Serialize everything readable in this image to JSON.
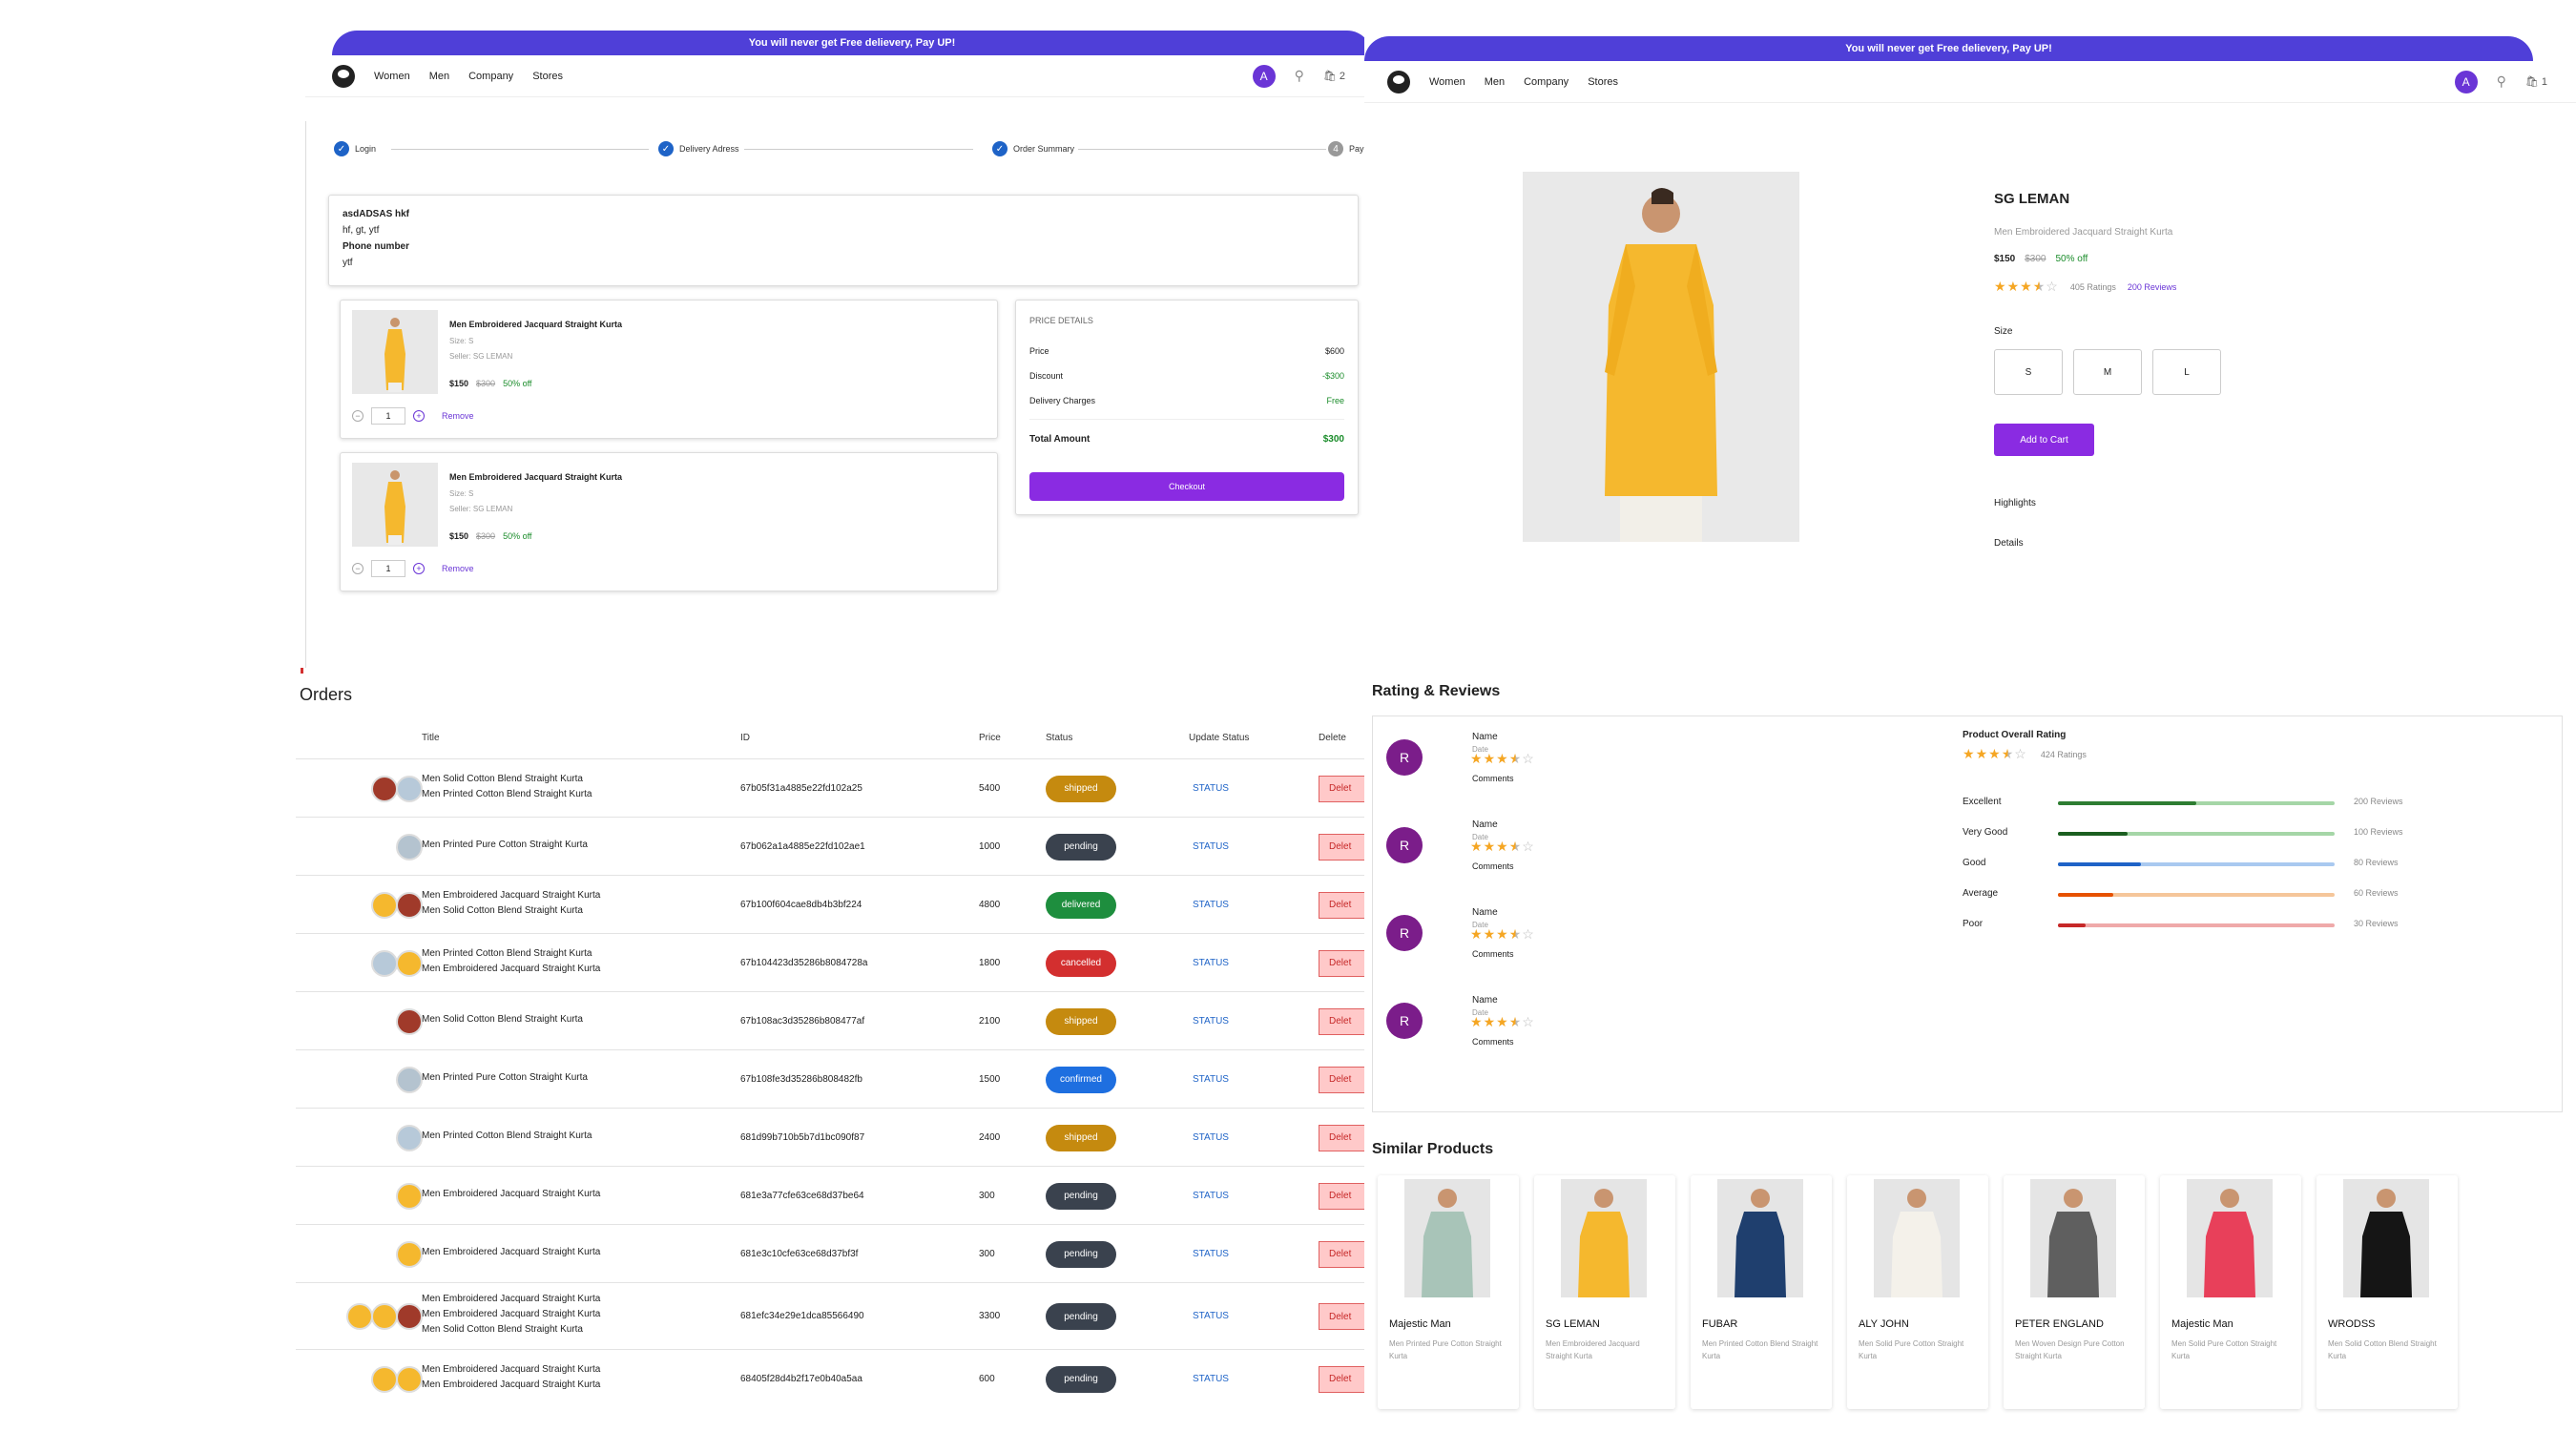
{
  "banner_text": "You will never get Free delievery, Pay UP!",
  "nav": {
    "women": "Women",
    "men": "Men",
    "company": "Company",
    "stores": "Stores",
    "avatar_letter": "A",
    "cart_count_left": "2",
    "cart_count_right": "1"
  },
  "checkout": {
    "steps": [
      "Login",
      "Delivery Adress",
      "Order Summary",
      "Payment"
    ],
    "address": {
      "name": "asdADSAS hkf",
      "line": "hf, gt, ytf",
      "phone_label": "Phone number",
      "phone": "ytf"
    },
    "items": [
      {
        "title": "Men Embroidered Jacquard Straight Kurta",
        "size": "Size: S",
        "seller": "Seller: SG LEMAN",
        "price": "$150",
        "mrp": "$300",
        "off": "50% off",
        "qty": "1",
        "remove": "Remove"
      },
      {
        "title": "Men Embroidered Jacquard Straight Kurta",
        "size": "Size: S",
        "seller": "Seller: SG LEMAN",
        "price": "$150",
        "mrp": "$300",
        "off": "50% off",
        "qty": "1",
        "remove": "Remove"
      }
    ],
    "price_details": {
      "heading": "PRICE DETAILS",
      "price_label": "Price",
      "price": "$600",
      "discount_label": "Discount",
      "discount": "-$300",
      "delivery_label": "Delivery Charges",
      "delivery": "Free",
      "total_label": "Total Amount",
      "total": "$300",
      "checkout": "Checkout"
    }
  },
  "product": {
    "brand": "SG LEMAN",
    "name": "Men Embroidered Jacquard Straight Kurta",
    "price": "$150",
    "mrp": "$300",
    "off": "50% off",
    "rating": 3.5,
    "ratings_text": "405 Ratings",
    "reviews_link": "200 Reviews",
    "size_label": "Size",
    "sizes": [
      "S",
      "M",
      "L"
    ],
    "add_to_cart": "Add to Cart",
    "highlights": "Highlights",
    "details": "Details"
  },
  "reviews": {
    "heading": "Rating & Reviews",
    "items": [
      {
        "initial": "R",
        "name": "Name",
        "date": "Date",
        "rating": 3.5,
        "comment": "Comments"
      },
      {
        "initial": "R",
        "name": "Name",
        "date": "Date",
        "rating": 3.5,
        "comment": "Comments"
      },
      {
        "initial": "R",
        "name": "Name",
        "date": "Date",
        "rating": 3.5,
        "comment": "Comments"
      },
      {
        "initial": "R",
        "name": "Name",
        "date": "Date",
        "rating": 3.5,
        "comment": "Comments"
      }
    ],
    "overall_title": "Product Overall Rating",
    "overall_rating": 3.5,
    "overall_count": "424 Ratings",
    "breakdown": [
      {
        "label": "Excellent",
        "count": "200 Reviews",
        "fraction": 0.5,
        "color": "#2e7d32",
        "bg": "#a5d6a7"
      },
      {
        "label": "Very Good",
        "count": "100 Reviews",
        "fraction": 0.25,
        "color": "#1b5e20",
        "bg": "#a5d6a7"
      },
      {
        "label": "Good",
        "count": "80 Reviews",
        "fraction": 0.3,
        "color": "#1e63c7",
        "bg": "#a9c9f0"
      },
      {
        "label": "Average",
        "count": "60 Reviews",
        "fraction": 0.2,
        "color": "#e65100",
        "bg": "#f5c69a"
      },
      {
        "label": "Poor",
        "count": "30 Reviews",
        "fraction": 0.1,
        "color": "#c62828",
        "bg": "#efa9a9"
      }
    ]
  },
  "similar": {
    "heading": "Similar Products",
    "items": [
      {
        "brand": "Majestic Man",
        "desc": "Men Printed Pure Cotton Straight Kurta",
        "color": "#a8c4b8"
      },
      {
        "brand": "SG LEMAN",
        "desc": "Men Embroidered Jacquard Straight Kurta",
        "color": "#f5b82e"
      },
      {
        "brand": "FUBAR",
        "desc": "Men Printed Cotton Blend Straight Kurta",
        "color": "#1f3f6e"
      },
      {
        "brand": "ALY JOHN",
        "desc": "Men Solid Pure Cotton Straight Kurta",
        "color": "#f4f1ea"
      },
      {
        "brand": "PETER ENGLAND",
        "desc": "Men Woven Design Pure Cotton Straight Kurta",
        "color": "#5f5f5f"
      },
      {
        "brand": "Majestic Man",
        "desc": "Men Solid Pure Cotton Straight Kurta",
        "color": "#e8405a"
      },
      {
        "brand": "WRODSS",
        "desc": "Men Solid Cotton Blend Straight Kurta",
        "color": "#151515"
      }
    ]
  },
  "orders": {
    "heading": "Orders",
    "columns": [
      "Title",
      "ID",
      "Price",
      "Status",
      "Update Status",
      "Delete"
    ],
    "status_link": "STATUS",
    "delete_label": "Delet",
    "rows": [
      {
        "titles": [
          "Men Solid Cotton Blend Straight Kurta",
          "Men Printed Cotton Blend Straight Kurta"
        ],
        "id": "67b05f31a4885e22fd102a25",
        "price": "5400",
        "status": "shipped",
        "thumbs": [
          "#a03a2a",
          "#b7c9d9"
        ]
      },
      {
        "titles": [
          "Men Printed Pure Cotton Straight Kurta"
        ],
        "id": "67b062a1a4885e22fd102ae1",
        "price": "1000",
        "status": "pending",
        "thumbs": [
          "#b4c3cf"
        ]
      },
      {
        "titles": [
          "Men Embroidered Jacquard Straight Kurta",
          "Men Solid Cotton Blend Straight Kurta"
        ],
        "id": "67b100f604cae8db4b3bf224",
        "price": "4800",
        "status": "delivered",
        "thumbs": [
          "#f5b82e",
          "#a03a2a"
        ]
      },
      {
        "titles": [
          "Men Printed Cotton Blend Straight Kurta",
          "Men Embroidered Jacquard Straight Kurta"
        ],
        "id": "67b104423d35286b8084728a",
        "price": "1800",
        "status": "cancelled",
        "thumbs": [
          "#b7c9d9",
          "#f5b82e"
        ]
      },
      {
        "titles": [
          "Men Solid Cotton Blend Straight Kurta"
        ],
        "id": "67b108ac3d35286b808477af",
        "price": "2100",
        "status": "shipped",
        "thumbs": [
          "#a03a2a"
        ]
      },
      {
        "titles": [
          "Men Printed Pure Cotton Straight Kurta"
        ],
        "id": "67b108fe3d35286b808482fb",
        "price": "1500",
        "status": "confirmed",
        "thumbs": [
          "#b4c3cf"
        ]
      },
      {
        "titles": [
          "Men Printed Cotton Blend Straight Kurta"
        ],
        "id": "681d99b710b5b7d1bc090f87",
        "price": "2400",
        "status": "shipped",
        "thumbs": [
          "#b7c9d9"
        ]
      },
      {
        "titles": [
          "Men Embroidered Jacquard Straight Kurta"
        ],
        "id": "681e3a77cfe63ce68d37be64",
        "price": "300",
        "status": "pending",
        "thumbs": [
          "#f5b82e"
        ]
      },
      {
        "titles": [
          "Men Embroidered Jacquard Straight Kurta"
        ],
        "id": "681e3c10cfe63ce68d37bf3f",
        "price": "300",
        "status": "pending",
        "thumbs": [
          "#f5b82e"
        ]
      },
      {
        "titles": [
          "Men Embroidered Jacquard Straight Kurta",
          "Men Embroidered Jacquard Straight Kurta",
          "Men Solid Cotton Blend Straight Kurta"
        ],
        "id": "681efc34e29e1dca85566490",
        "price": "3300",
        "status": "pending",
        "thumbs": [
          "#f5b82e",
          "#f5b82e",
          "#a03a2a"
        ]
      },
      {
        "titles": [
          "Men Embroidered Jacquard Straight Kurta",
          "Men Embroidered Jacquard Straight Kurta"
        ],
        "id": "68405f28d4b2f17e0b40a5aa",
        "price": "600",
        "status": "pending",
        "thumbs": [
          "#f5b82e",
          "#f5b82e"
        ]
      }
    ],
    "status_colors": {
      "shipped": "#c58a0f",
      "pending": "#3a424e",
      "delivered": "#1e8e3e",
      "cancelled": "#d32f2f",
      "confirmed": "#1e6fe0"
    }
  }
}
